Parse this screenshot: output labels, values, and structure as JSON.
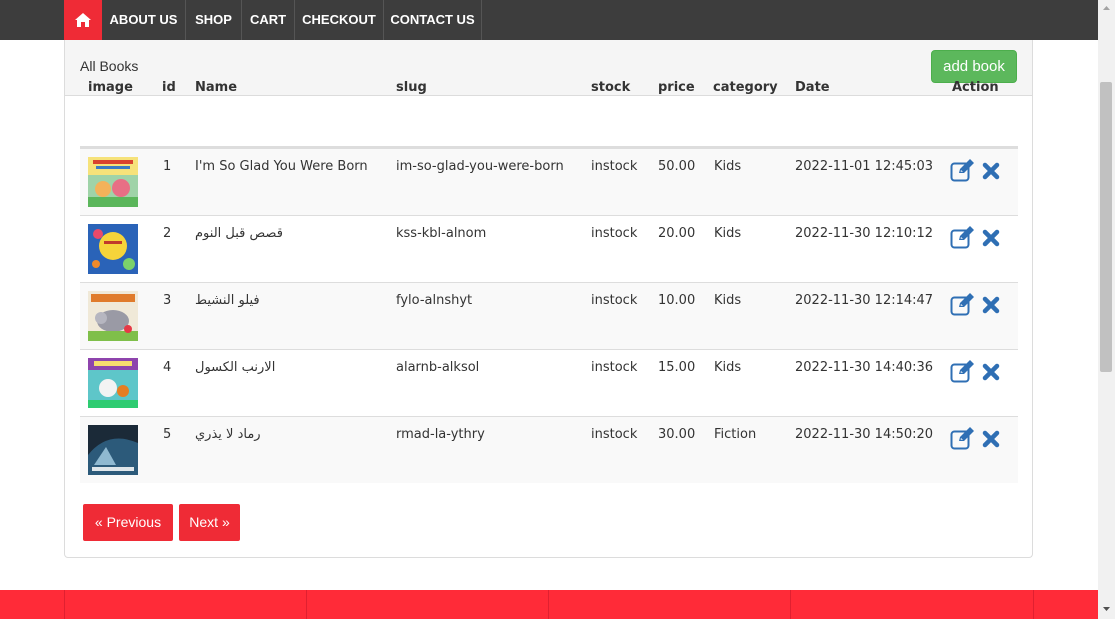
{
  "nav": {
    "items": [
      {
        "label": "ABOUT US"
      },
      {
        "label": "SHOP"
      },
      {
        "label": "CART"
      },
      {
        "label": "CHECKOUT"
      },
      {
        "label": "CONTACT US"
      }
    ]
  },
  "panel": {
    "title": "All Books",
    "add_label": "add book"
  },
  "table": {
    "headers": [
      "image",
      "id",
      "Name",
      "slug",
      "stock",
      "price",
      "category",
      "Date",
      "Action"
    ],
    "rows": [
      {
        "id": "1",
        "name": "I'm So Glad You Were Born",
        "slug": "im-so-glad-you-were-born",
        "stock": "instock",
        "price": "50.00",
        "category": "Kids",
        "date": "2022-11-01 12:45:03"
      },
      {
        "id": "2",
        "name": "قصص قبل النوم",
        "slug": "kss-kbl-alnom",
        "stock": "instock",
        "price": "20.00",
        "category": "Kids",
        "date": "2022-11-30 12:10:12"
      },
      {
        "id": "3",
        "name": "فيلو النشيط",
        "slug": "fylo-alnshyt",
        "stock": "instock",
        "price": "10.00",
        "category": "Kids",
        "date": "2022-11-30 12:14:47"
      },
      {
        "id": "4",
        "name": "الارنب الكسول",
        "slug": "alarnb-alksol",
        "stock": "instock",
        "price": "15.00",
        "category": "Kids",
        "date": "2022-11-30 14:40:36"
      },
      {
        "id": "5",
        "name": "رماد لا يذري",
        "slug": "rmad-la-ythry",
        "stock": "instock",
        "price": "30.00",
        "category": "Fiction",
        "date": "2022-11-30 14:50:20"
      }
    ]
  },
  "pager": {
    "prev": "« Previous",
    "next": "Next »"
  },
  "colors": {
    "accent_red": "#ef2b36",
    "nav_bg": "#3d3d3d",
    "add_green": "#5cb85c",
    "action_blue": "#2f6fb4"
  },
  "icons": {
    "home": "home-icon",
    "edit": "edit-icon",
    "delete": "close-icon"
  }
}
